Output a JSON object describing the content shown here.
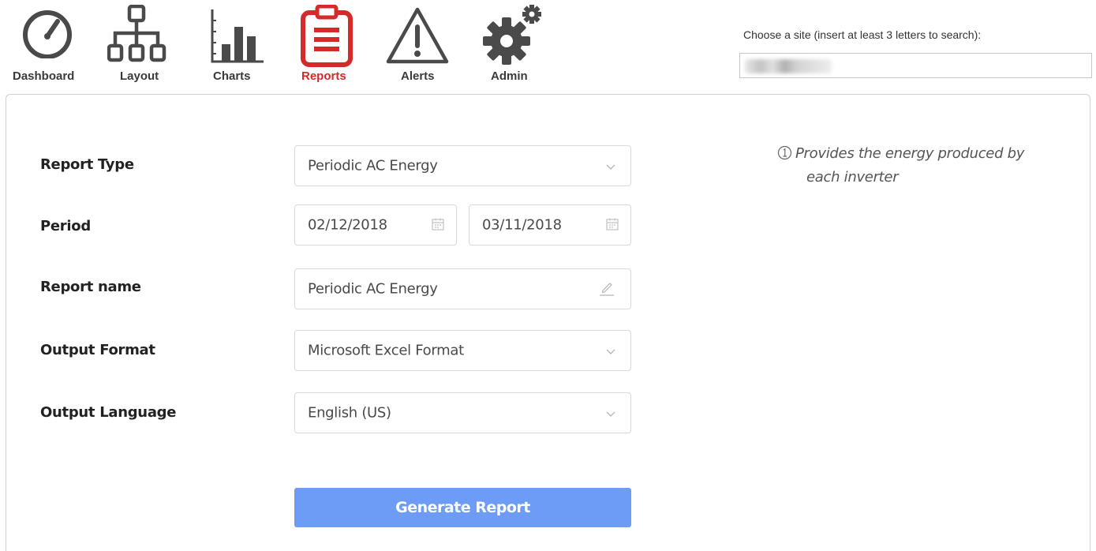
{
  "nav": {
    "items": [
      {
        "label": "Dashboard",
        "icon": "dashboard-gauge-icon"
      },
      {
        "label": "Layout",
        "icon": "layout-sitemap-icon"
      },
      {
        "label": "Charts",
        "icon": "bar-chart-icon"
      },
      {
        "label": "Reports",
        "icon": "clipboard-report-icon",
        "active": true
      },
      {
        "label": "Alerts",
        "icon": "warning-triangle-icon"
      },
      {
        "label": "Admin",
        "icon": "gears-icon"
      }
    ],
    "active_color": "#d42a2a",
    "inactive_color": "#3a3a3a"
  },
  "site_search": {
    "label": "Choose a site (insert at least 3 letters to search):",
    "value": ""
  },
  "form": {
    "report_type": {
      "label": "Report Type",
      "value": "Periodic AC Energy"
    },
    "period": {
      "label": "Period",
      "start": "02/12/2018",
      "end": "03/11/2018"
    },
    "report_name": {
      "label": "Report name",
      "value": "Periodic AC Energy"
    },
    "output_format": {
      "label": "Output Format",
      "value": "Microsoft Excel Format"
    },
    "output_language": {
      "label": "Output Language",
      "value": "English (US)"
    }
  },
  "info": {
    "line1": "Provides the energy produced by",
    "line2": "each inverter"
  },
  "generate_button": {
    "label": "Generate Report",
    "color": "#6c9cf6"
  }
}
